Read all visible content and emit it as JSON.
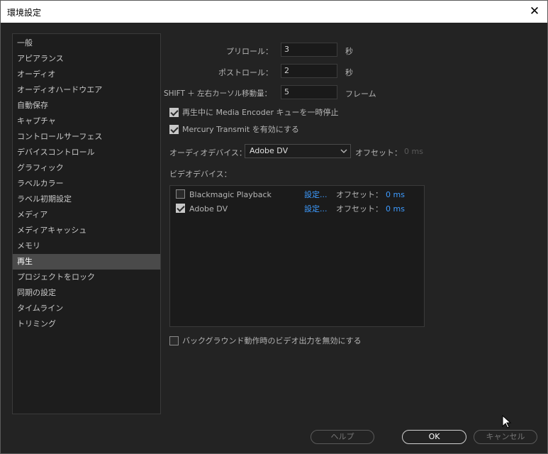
{
  "window": {
    "title": "環境設定"
  },
  "sidebar": {
    "items": [
      {
        "label": "一般"
      },
      {
        "label": "アピアランス"
      },
      {
        "label": "オーディオ"
      },
      {
        "label": "オーディオハードウエア"
      },
      {
        "label": "自動保存"
      },
      {
        "label": "キャプチャ"
      },
      {
        "label": "コントロールサーフェス"
      },
      {
        "label": "デバイスコントロール"
      },
      {
        "label": "グラフィック"
      },
      {
        "label": "ラベルカラー"
      },
      {
        "label": "ラベル初期設定"
      },
      {
        "label": "メディア"
      },
      {
        "label": "メディアキャッシュ"
      },
      {
        "label": "メモリ"
      },
      {
        "label": "再生"
      },
      {
        "label": "プロジェクトをロック"
      },
      {
        "label": "同期の設定"
      },
      {
        "label": "タイムライン"
      },
      {
        "label": "トリミング"
      }
    ],
    "selected": "再生"
  },
  "playback": {
    "preroll": {
      "label": "プリロール：",
      "value": "3",
      "unit": "秒"
    },
    "postroll": {
      "label": "ポストロール：",
      "value": "2",
      "unit": "秒"
    },
    "shift": {
      "label": "SHIFT ＋ 左右カーソル移動量：",
      "value": "5",
      "unit": "フレーム"
    },
    "pause_encoder": {
      "label": "再生中に Media  Encoder キューを一時停止",
      "checked": true
    },
    "mercury": {
      "label": "Mercury  Transmit を有効にする",
      "checked": true
    },
    "audio_device": {
      "label": "オーディオデバイス：",
      "value": "Adobe DV",
      "offset_label": "オフセット：",
      "offset_value": "0 ms"
    },
    "video_label": "ビデオデバイス：",
    "video_devices": [
      {
        "name": "Blackmagic Playback",
        "checked": false,
        "settings": "設定...",
        "offset_label": "オフセット：",
        "offset_value": "0 ms"
      },
      {
        "name": "Adobe DV",
        "checked": true,
        "settings": "設定...",
        "offset_label": "オフセット：",
        "offset_value": "0 ms"
      }
    ],
    "disable_bg": {
      "label": "バックグラウンド動作時のビデオ出力を無効にする",
      "checked": false
    }
  },
  "buttons": {
    "help": "ヘルプ",
    "ok": "OK",
    "cancel": "キャンセル"
  },
  "colors": {
    "link": "#3d9bff",
    "background": "#232323",
    "selected": "#4a4a4a"
  }
}
